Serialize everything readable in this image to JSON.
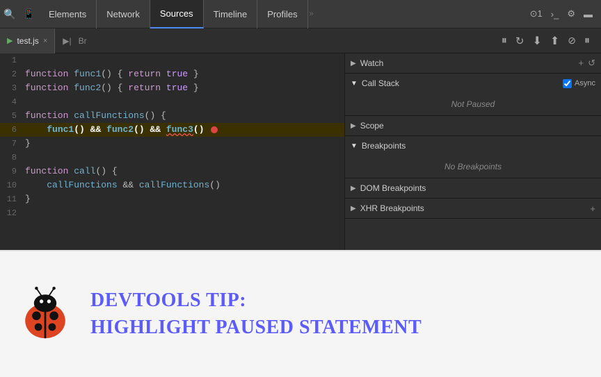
{
  "toolbar": {
    "tabs": [
      {
        "label": "Elements",
        "active": false
      },
      {
        "label": "Network",
        "active": false
      },
      {
        "label": "Sources",
        "active": true
      },
      {
        "label": "Timeline",
        "active": false
      },
      {
        "label": "Profiles",
        "active": false
      }
    ],
    "rightItems": [
      "1",
      "›_",
      "⚙",
      "▬"
    ]
  },
  "file_toolbar": {
    "filename": "test.js",
    "close_label": "×",
    "icons": [
      "▶|",
      "Br"
    ]
  },
  "debug_controls": {
    "pause": "⏸",
    "step_over": "↺",
    "step_into": "↓",
    "step_out": "↑",
    "deactivate": "⊘",
    "pause2": "⏸"
  },
  "code": {
    "lines": [
      {
        "num": "1",
        "text": ""
      },
      {
        "num": "2",
        "text": "function func1() { return true }"
      },
      {
        "num": "3",
        "text": "function func2() { return true }"
      },
      {
        "num": "4",
        "text": ""
      },
      {
        "num": "5",
        "text": "function callFunctions() {"
      },
      {
        "num": "6",
        "text": "    func1() && func2() && func3()"
      },
      {
        "num": "7",
        "text": "}"
      },
      {
        "num": "8",
        "text": ""
      },
      {
        "num": "9",
        "text": "function call() {"
      },
      {
        "num": "10",
        "text": "    callFunctions && callFunctions()"
      },
      {
        "num": "11",
        "text": "}"
      },
      {
        "num": "12",
        "text": ""
      }
    ]
  },
  "right_panel": {
    "watch": {
      "label": "Watch",
      "actions": [
        "+",
        "↺"
      ],
      "expanded": true
    },
    "call_stack": {
      "label": "Call Stack",
      "expanded": true,
      "status": "Not Paused",
      "async_label": "Async",
      "async_checked": true
    },
    "scope": {
      "label": "Scope",
      "expanded": false
    },
    "breakpoints": {
      "label": "Breakpoints",
      "expanded": true,
      "status": "No Breakpoints"
    },
    "dom_breakpoints": {
      "label": "DOM Breakpoints",
      "expanded": false
    },
    "xhr_breakpoints": {
      "label": "XHR Breakpoints",
      "expanded": false
    }
  },
  "tip": {
    "title": "DevTools Tip:",
    "subtitle": "Highlight Paused Statement"
  }
}
